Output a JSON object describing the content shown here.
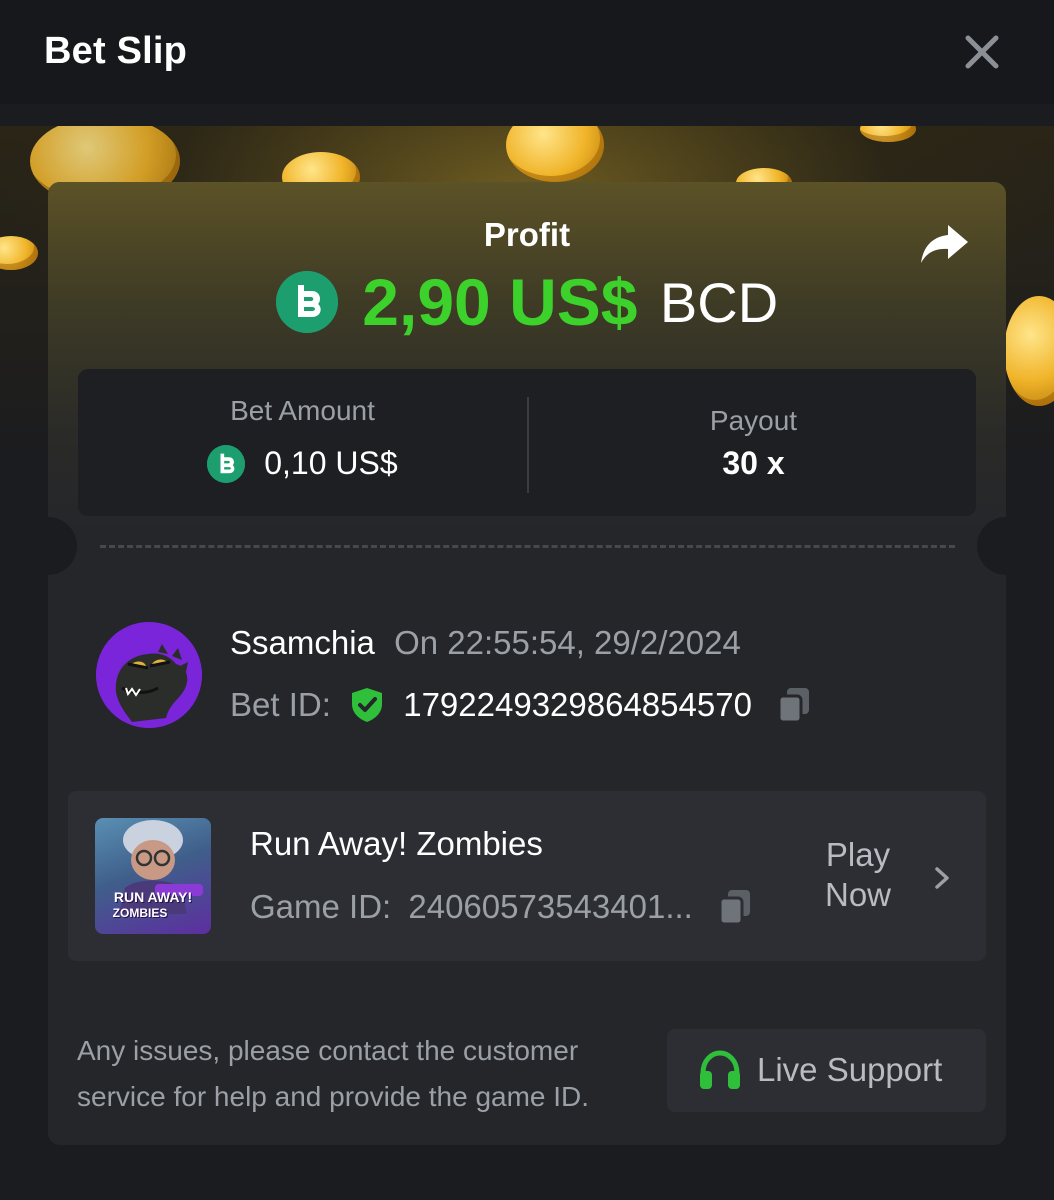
{
  "header": {
    "title": "Bet Slip"
  },
  "profit": {
    "label": "Profit",
    "amount": "2,90 US$",
    "currency": "BCD",
    "coin_icon": "bcd-coin-icon"
  },
  "stats": {
    "bet_amount_label": "Bet Amount",
    "bet_amount_value": "0,10 US$",
    "payout_label": "Payout",
    "payout_value": "30 x"
  },
  "bet_info": {
    "username": "Ssamchia",
    "on_text": "On 22:55:54, 29/2/2024",
    "bet_id_label": "Bet ID:",
    "bet_id": "1792249329864854570"
  },
  "game": {
    "name": "Run Away! Zombies",
    "game_id_label": "Game ID:",
    "game_id": "24060573543401...",
    "play_now": "Play Now",
    "thumb_text_1": "RUN AWAY!",
    "thumb_text_2": "ZOMBIES"
  },
  "footer": {
    "help_text": "Any issues, please contact the customer service for help and provide the game ID.",
    "support_label": "Live Support"
  },
  "colors": {
    "profit_green": "#3cd12b",
    "bcd_green": "#1d9e6e",
    "shield_green": "#2fbf3a",
    "background": "#1a1c1f",
    "card": "#24262a"
  }
}
